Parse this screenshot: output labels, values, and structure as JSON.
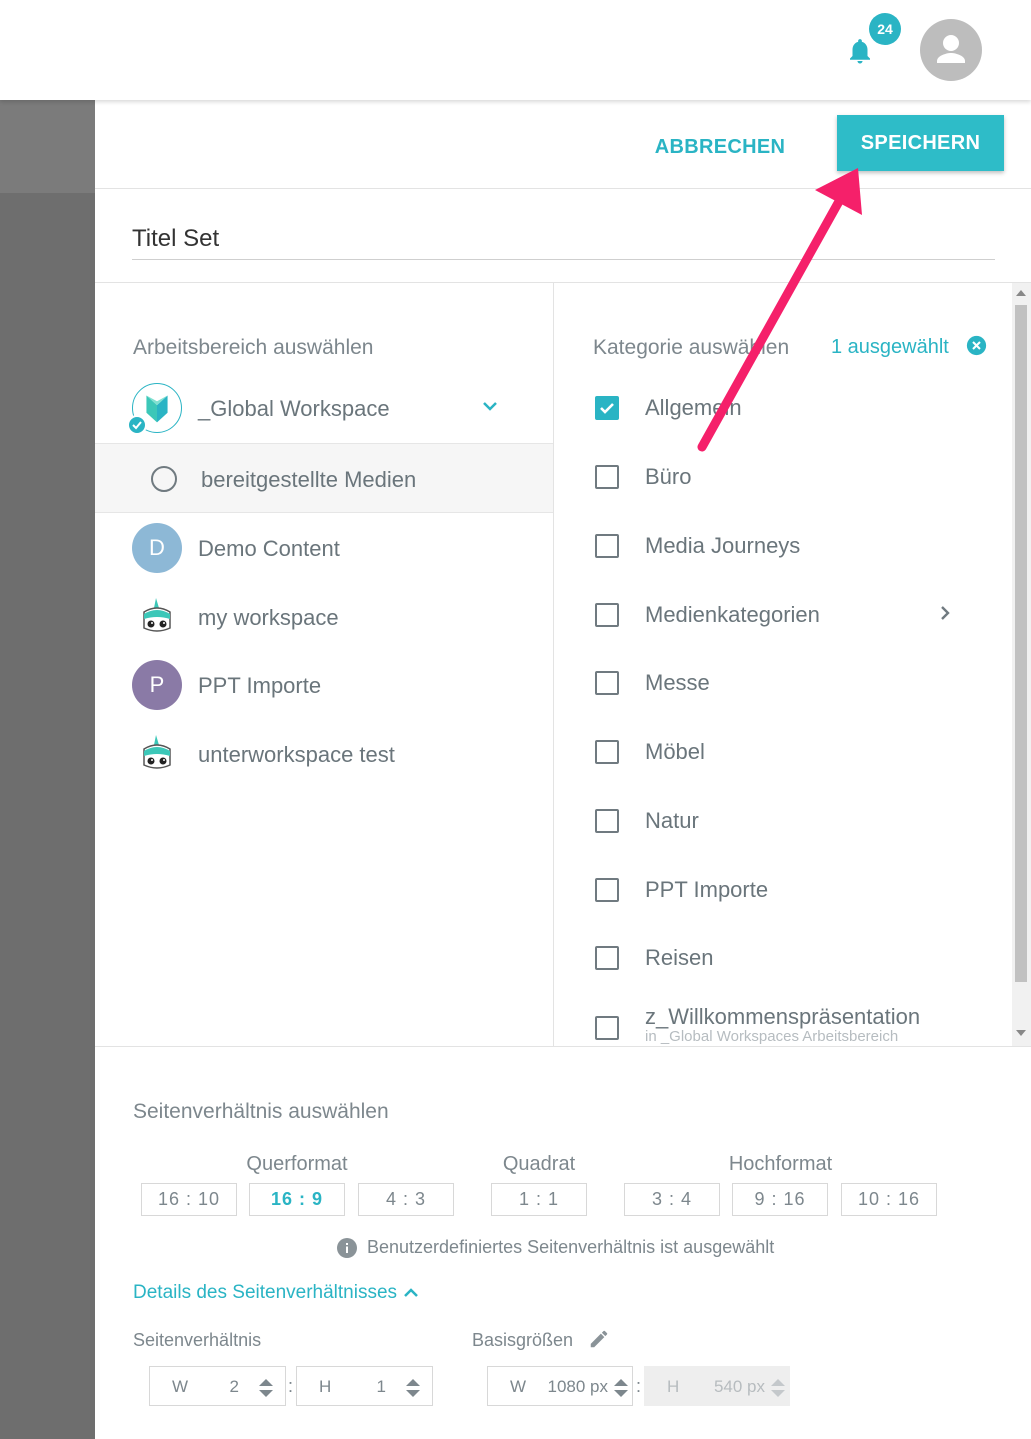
{
  "topbar": {
    "notifications_count": "24",
    "bell_icon": "bell-icon",
    "avatar_icon": "user-icon"
  },
  "header": {
    "cancel_label": "ABBRECHEN",
    "save_label": "SPEICHERN"
  },
  "title_field": {
    "value": "Titel Set"
  },
  "workspace": {
    "heading": "Arbeitsbereich auswählen",
    "items": [
      {
        "label": "_Global Workspace"
      },
      {
        "label": "bereitgestellte Medien"
      },
      {
        "label": "Demo Content",
        "initial": "D",
        "color": "#8db8d6"
      },
      {
        "label": "my workspace"
      },
      {
        "label": "PPT Importe",
        "initial": "P",
        "color": "#8a7aa6"
      },
      {
        "label": "unterworkspace test"
      }
    ]
  },
  "category": {
    "heading": "Kategorie auswählen",
    "selected_count": "1 ausgewählt",
    "items": [
      {
        "label": "Allgemein",
        "checked": true
      },
      {
        "label": "Büro",
        "checked": false
      },
      {
        "label": "Media Journeys",
        "checked": false
      },
      {
        "label": "Medienkategorien",
        "checked": false
      },
      {
        "label": "Messe",
        "checked": false
      },
      {
        "label": "Möbel",
        "checked": false
      },
      {
        "label": "Natur",
        "checked": false
      },
      {
        "label": "PPT Importe",
        "checked": false
      },
      {
        "label": "Reisen",
        "checked": false
      },
      {
        "label": "z_Willkommenspräsentation",
        "sub": "in _Global Workspaces Arbeitsbereich",
        "checked": false
      }
    ]
  },
  "aspect": {
    "heading": "Seitenverhältnis auswählen",
    "groups": [
      "Querformat",
      "Quadrat",
      "Hochformat"
    ],
    "ratios": [
      "16 : 10",
      "16 : 9",
      "4 : 3",
      "1 : 1",
      "3 : 4",
      "9 : 16",
      "10 : 16"
    ],
    "active_ratio": "16 : 9",
    "info": "Benutzerdefiniertes Seitenverhältnis ist ausgewählt",
    "details_link": "Details des Seitenverhältnisses",
    "ratio_label": "Seitenverhältnis",
    "base_label": "Basisgrößen",
    "ratio_w_letter": "W",
    "ratio_w": "2",
    "ratio_h_letter": "H",
    "ratio_h": "1",
    "base_w_letter": "W",
    "base_w": "1080 px",
    "base_h_letter": "H",
    "base_h": "540 px"
  },
  "colors": {
    "accent": "#2ab4c4",
    "annotation_arrow": "#f5206a"
  }
}
